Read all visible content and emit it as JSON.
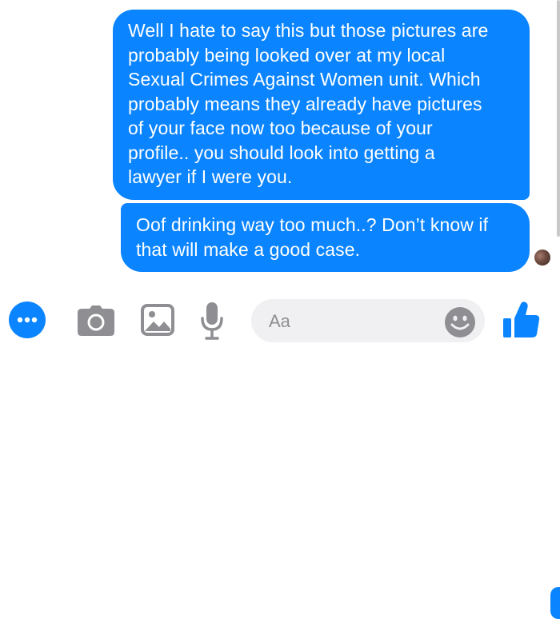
{
  "conversation": {
    "messages": [
      {
        "sender": "me",
        "lines": [
          "Well I hate to say this but those pictures are",
          "probably being looked over at my local",
          "Sexual Crimes Against Women unit. Which",
          "probably means they already have pictures",
          "of your face now too because of your",
          "profile.. you should look into getting a",
          "lawyer if I were you."
        ]
      },
      {
        "sender": "me",
        "lines": [
          "Oof drinking way too much..? Don’t know if",
          "that will make a good case."
        ]
      }
    ]
  },
  "composer": {
    "placeholder": "Aa",
    "value": "",
    "icons": [
      "more-icon",
      "camera-icon",
      "photo-icon",
      "microphone-icon",
      "emoji-icon",
      "thumbs-up-icon"
    ]
  },
  "colors": {
    "accent": "#0a84ff",
    "bubble_text": "#ffffff",
    "icon_gray": "#8e8e93",
    "input_bg": "#f0f0f2"
  }
}
